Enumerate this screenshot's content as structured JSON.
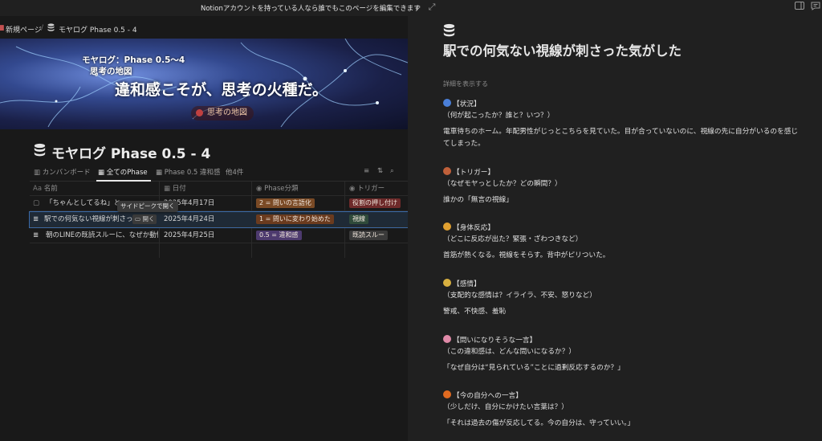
{
  "topbar": {
    "notice": "Notionアカウントを持っている人なら誰でもこのページを編集できます"
  },
  "breadcrumb": {
    "parent": "新規ページ",
    "sep": "/",
    "current": "モヤログ Phase 0.5 - 4"
  },
  "banner": {
    "line1": "モヤログ：Phase 0.5〜4",
    "line2": "思考の地図",
    "headline": "違和感こそが、思考の火種だ。",
    "pill": "思考の地図"
  },
  "database": {
    "title": "モヤログ Phase 0.5 - 4",
    "tabs": [
      "カンバンボード",
      "全てのPhase",
      "Phase 0.5 違和感",
      "他4件"
    ],
    "columns": [
      "名前",
      "日付",
      "Phase分類",
      "トリガー"
    ],
    "rows": [
      {
        "name": "「ちゃんとしてるね」と",
        "date": "2025年4月17日",
        "phase": "2 = 問いの言語化",
        "trigger": "役割の押し付け"
      },
      {
        "name": "駅での何気ない視線が刺さっ",
        "date": "2025年4月24日",
        "phase": "1 = 問いに変わり始めた",
        "trigger": "視線"
      },
      {
        "name": "朝のLINEの既読スルーに、なぜか動悸",
        "date": "2025年4月25日",
        "phase": "0.5 = 違和感",
        "trigger": "既読スルー"
      }
    ],
    "open_label": "開く",
    "tooltip": "サイドピークで開く"
  },
  "peek": {
    "title": "駅での何気ない視線が刺さった気がした",
    "show_details": "詳細を表示する",
    "sections": [
      {
        "icon": "cyclone-icon",
        "heading": "【状況】",
        "question": "（何が起こったか？誰と？いつ？）",
        "answer": "電車待ちのホーム。年配男性がじっとこちらを見ていた。目が合っていないのに、視線の先に自分がいるのを感じてしまった。"
      },
      {
        "icon": "guitar-icon",
        "heading": "【トリガー】",
        "question": "（なぜモヤっとしたか？どの瞬間？）",
        "answer": "誰かの「無言の視線」"
      },
      {
        "icon": "collision-icon",
        "heading": "【身体反応】",
        "question": "（どこに反応が出た？緊張・ざわつきなど）",
        "answer": "首筋が熱くなる。視線をそらす。背中がピリついた。"
      },
      {
        "icon": "face-icon",
        "heading": "【感情】",
        "question": "（支配的な感情は？イライラ、不安、怒りなど）",
        "answer": "警戒、不快感、羞恥"
      },
      {
        "icon": "brain-icon",
        "heading": "【問いになりそうな一言】",
        "question": "（この違和感は、どんな問いになるか？）",
        "answer": "「なぜ自分は“見られている”ことに過剰反応するのか？」"
      },
      {
        "icon": "fire-icon",
        "heading": "【今の自分への一言】",
        "question": "（少しだけ、自分にかけたい言葉は？）",
        "answer": "「それは過去の傷が反応してる。今の自分は、守っていい。」"
      }
    ]
  },
  "colors": {
    "tag_phase2": "#7a4a25",
    "tag_phase1": "#6b3b1e",
    "tag_phase05": "#4d3a6e",
    "tag_trigger1": "#6e2a2a",
    "tag_trigger2": "#2f4a3a",
    "tag_trigger3": "#3a3a3a"
  }
}
